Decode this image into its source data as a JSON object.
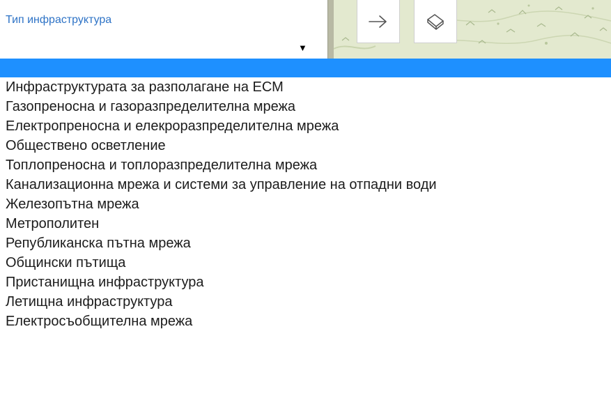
{
  "filter": {
    "label": "Тип инфраструктура",
    "selected_value": "",
    "arrow_glyph": "▼"
  },
  "map_buttons": [
    {
      "icon": "arrow-right-icon"
    },
    {
      "icon": "eraser-icon"
    }
  ],
  "dropdown": {
    "highlighted_index": 0,
    "options": [
      "",
      "Инфраструктурата за разполагане на ЕСМ",
      "Газопреносна и газоразпределителна мрежа",
      "Електропреносна и елекроразпределителна мрежа",
      "Обществено осветление",
      "Топлопреносна и топлоразпределителна мрежа",
      "Канализационна мрежа и системи за управление на отпадни води",
      "Железопътна мрежа",
      "Метрополитен",
      "Републиканска пътна мрежа",
      "Общински пътища",
      "Пристанищна инфраструктура",
      "Летищна инфраструктура",
      "Електросъобщителна мрежа"
    ]
  },
  "colors": {
    "label_blue": "#2e73c6",
    "highlight_blue": "#1e90ff",
    "map_background": "#e3e9cf"
  }
}
